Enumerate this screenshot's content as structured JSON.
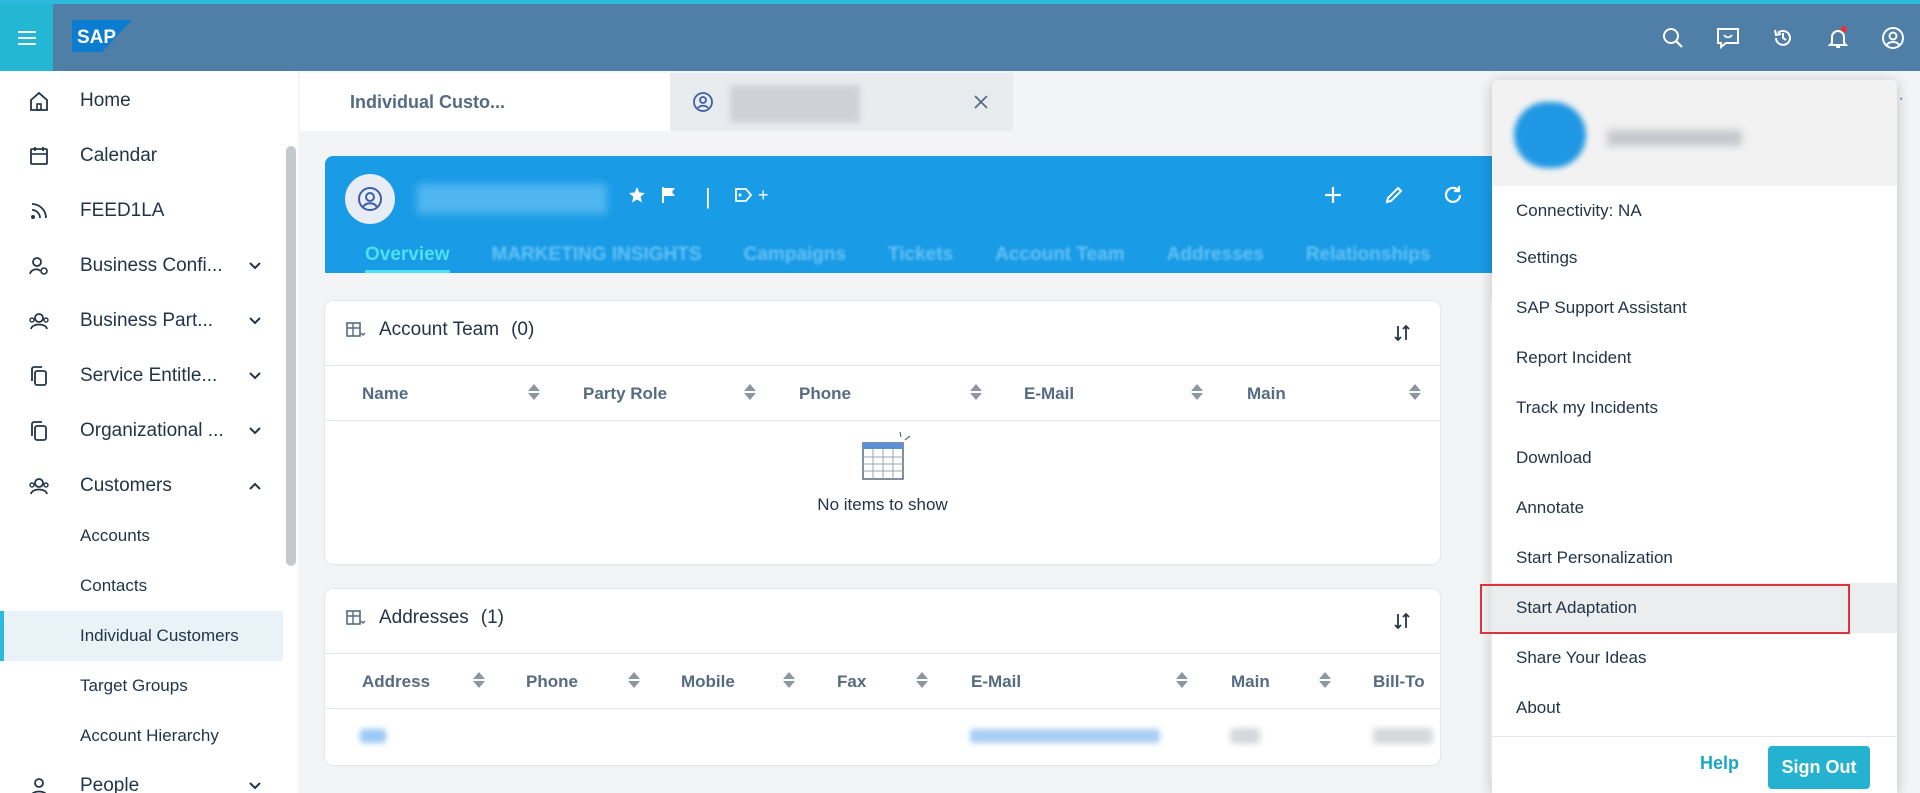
{
  "shell": {
    "logo": "SAP",
    "icons": [
      "search-icon",
      "chat-icon",
      "history-icon",
      "bell-icon",
      "user-icon"
    ]
  },
  "sidebar": {
    "items": [
      {
        "label": "Home",
        "icon": "home-icon"
      },
      {
        "label": "Calendar",
        "icon": "calendar-icon"
      },
      {
        "label": "FEED1LA",
        "icon": "feed-icon"
      },
      {
        "label": "Business Confi...",
        "icon": "settings-person-icon",
        "expandable": true
      },
      {
        "label": "Business Part...",
        "icon": "group-icon",
        "expandable": true
      },
      {
        "label": "Service Entitle...",
        "icon": "copy-icon",
        "expandable": true
      },
      {
        "label": "Organizational ...",
        "icon": "copy-icon",
        "expandable": true
      },
      {
        "label": "Customers",
        "icon": "group-icon",
        "expanded": true
      },
      {
        "label": "People",
        "icon": "person-icon",
        "expandable": true
      }
    ],
    "customers_sub": [
      "Accounts",
      "Contacts",
      "Individual Customers",
      "Target Groups",
      "Account Hierarchy"
    ],
    "selected": "Individual Customers"
  },
  "tabs": {
    "tab1": "Individual Custo..."
  },
  "object_header": {
    "tag_plus": "+",
    "separator": "|",
    "tabs": [
      "Overview",
      "MARKETING INSIGHTS",
      "Campaigns",
      "Tickets",
      "Account Team",
      "Addresses",
      "Relationships"
    ],
    "active_tab": "Overview"
  },
  "account_team": {
    "title": "Account Team",
    "count": "(0)",
    "columns": [
      "Name",
      "Party Role",
      "Phone",
      "E-Mail",
      "Main"
    ],
    "empty_text": "No items to show"
  },
  "addresses": {
    "title": "Addresses",
    "count": "(1)",
    "columns": [
      "Address",
      "Phone",
      "Mobile",
      "Fax",
      "E-Mail",
      "Main",
      "Bill-To"
    ]
  },
  "user_menu": {
    "items": [
      "Connectivity: NA",
      "Settings",
      "SAP Support Assistant",
      "Report Incident",
      "Track my Incidents",
      "Download",
      "Annotate",
      "Start Personalization",
      "Start Adaptation",
      "Share Your Ideas",
      "About"
    ],
    "highlighted": "Start Adaptation",
    "help": "Help",
    "sign_out": "Sign Out"
  },
  "colors": {
    "shell": "#4f7fa7",
    "accent": "#2dbadc",
    "header": "#1a9be6",
    "highlight_border": "#d9353a"
  }
}
